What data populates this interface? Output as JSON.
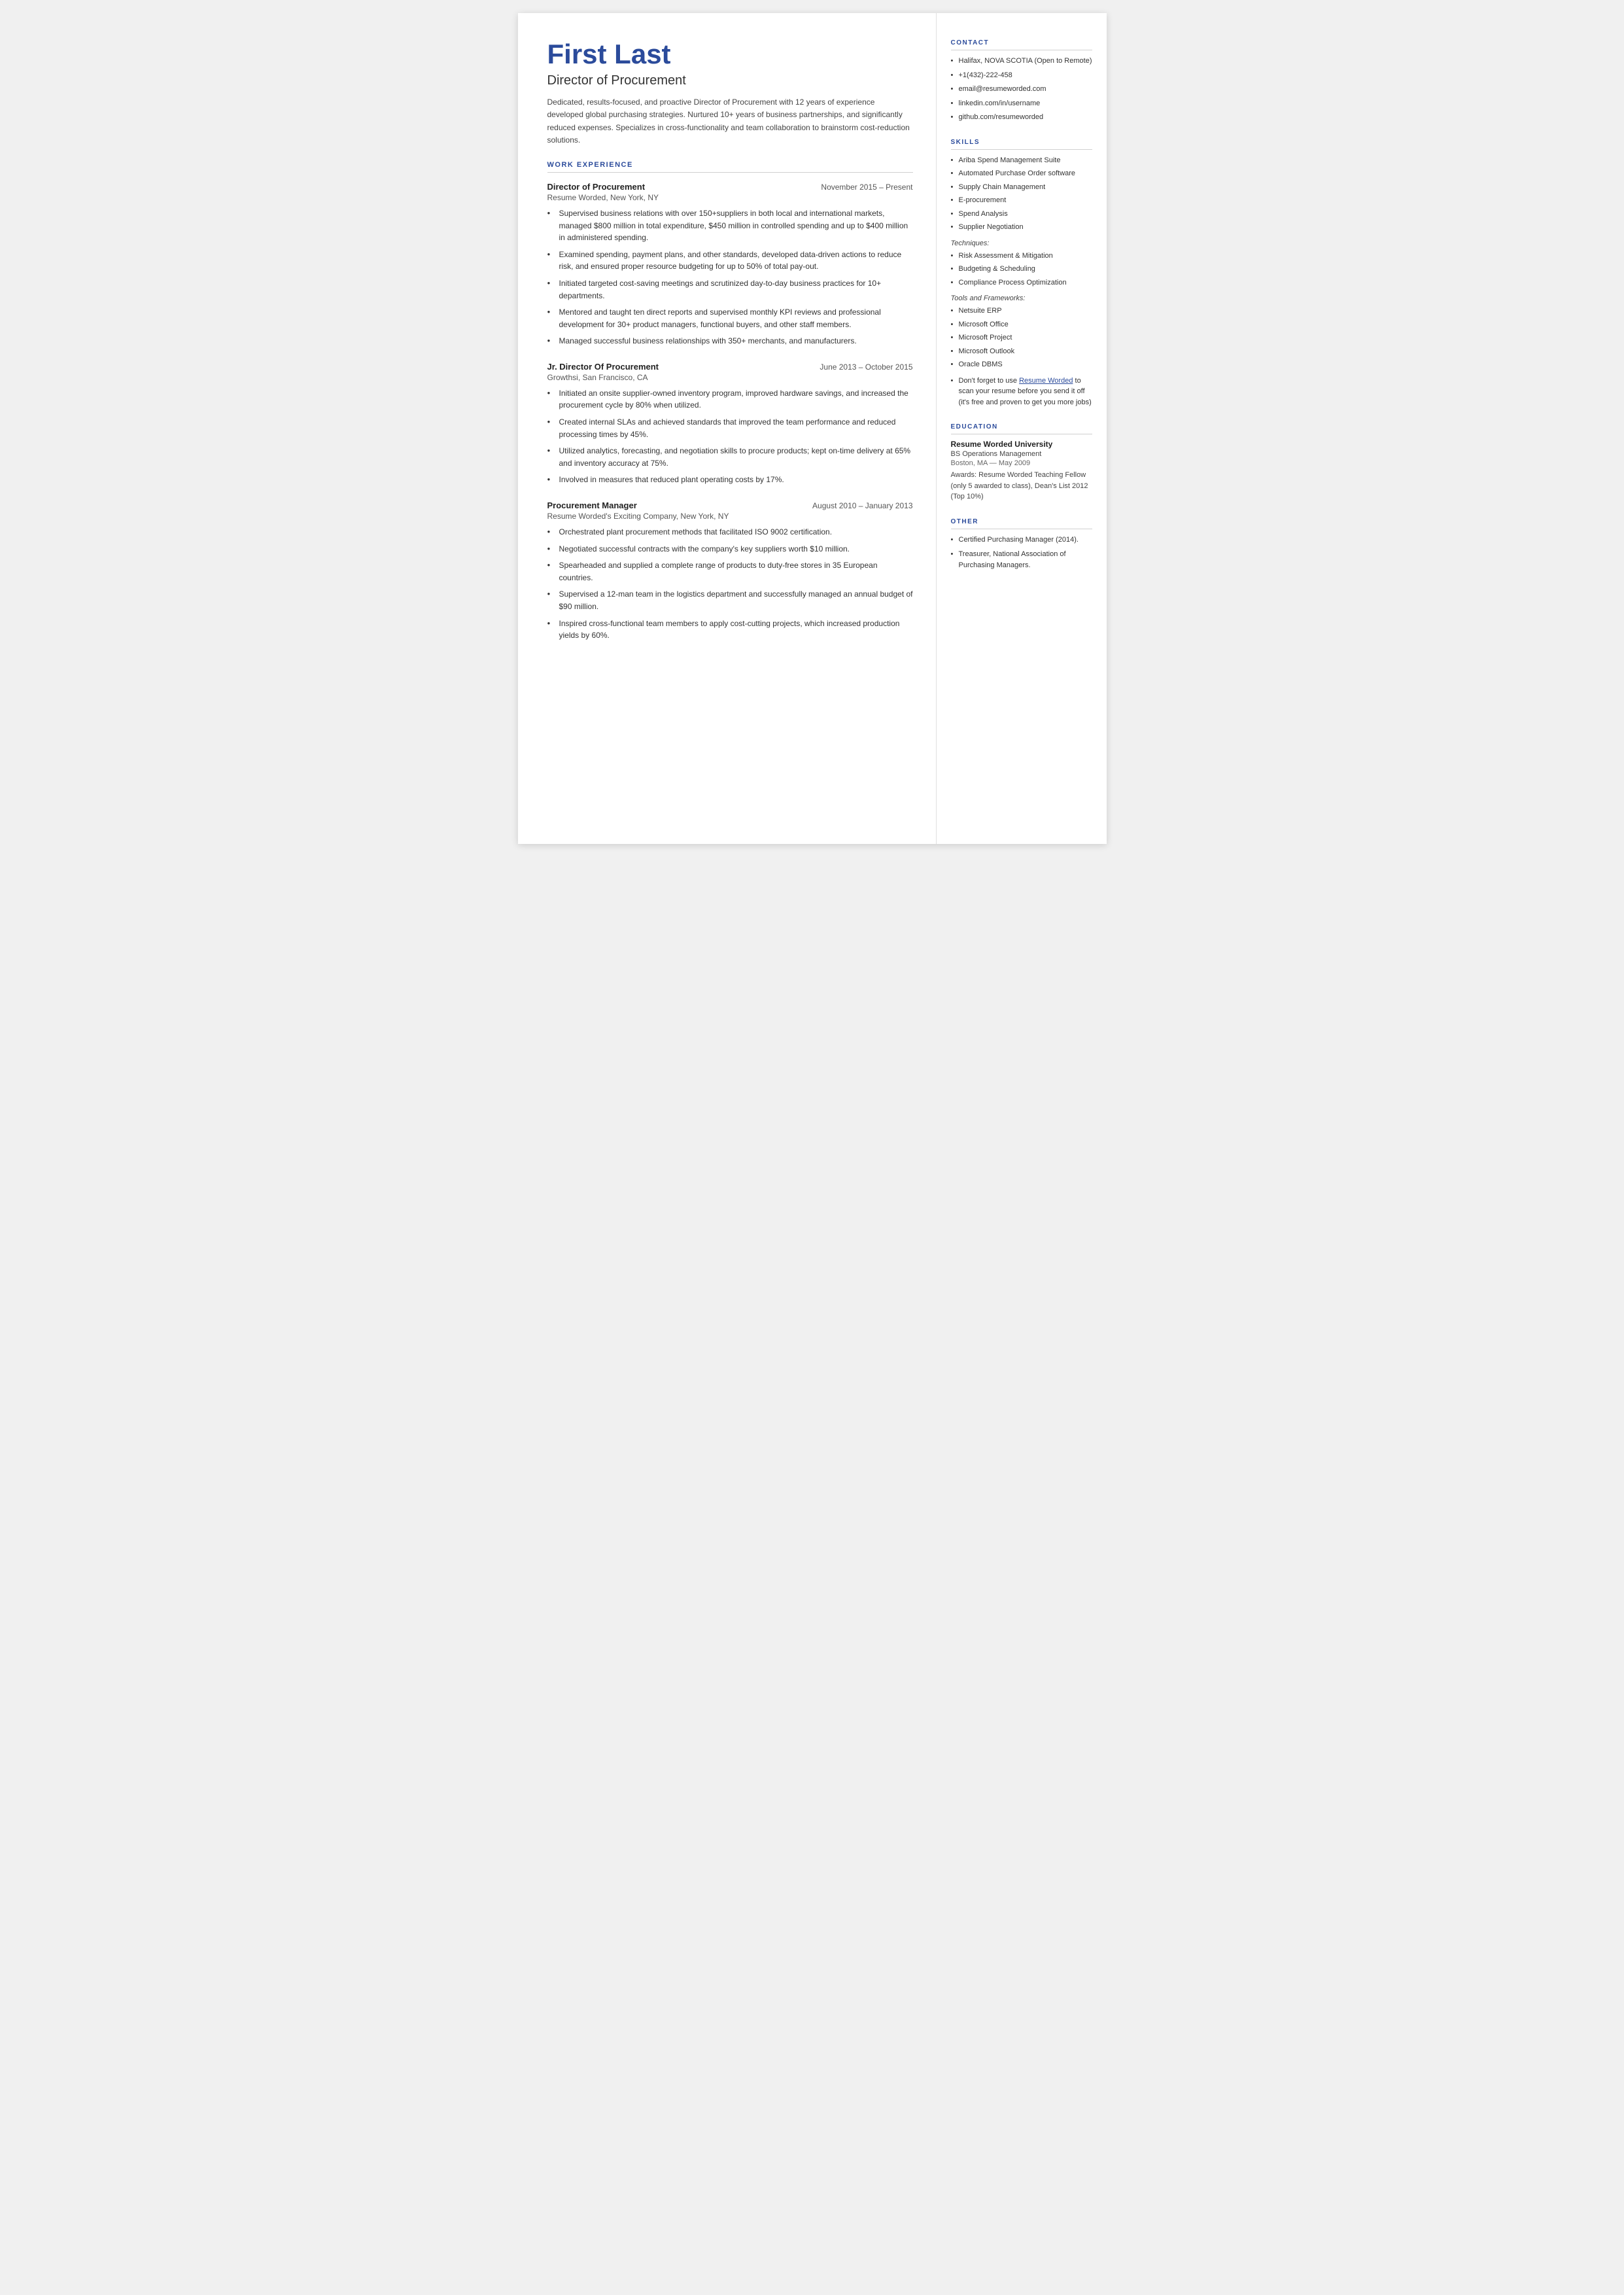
{
  "header": {
    "name": "First Last",
    "title": "Director of Procurement",
    "summary": "Dedicated, results-focused, and proactive Director of Procurement with 12 years of experience developed global purchasing strategies. Nurtured 10+ years of business partnerships, and significantly reduced expenses. Specializes in cross-functionality and team collaboration to brainstorm cost-reduction solutions."
  },
  "sections": {
    "work_experience_label": "WORK EXPERIENCE",
    "jobs": [
      {
        "title": "Director of Procurement",
        "dates": "November 2015 – Present",
        "company": "Resume Worded, New York, NY",
        "bullets": [
          "Supervised business relations with over 150+suppliers in both local and international markets, managed $800 million in total expenditure, $450 million in controlled spending and up to $400 million in administered spending.",
          "Examined spending, payment plans, and other standards, developed data-driven actions to reduce risk, and ensured proper resource budgeting for up to 50% of total pay-out.",
          "Initiated targeted cost-saving meetings and scrutinized day-to-day business practices for 10+ departments.",
          "Mentored and taught ten direct reports and supervised monthly KPI reviews and professional development for 30+ product managers, functional buyers, and other staff members.",
          "Managed successful business relationships with 350+ merchants, and manufacturers."
        ]
      },
      {
        "title": "Jr. Director Of Procurement",
        "dates": "June 2013 – October 2015",
        "company": "Growthsi, San Francisco, CA",
        "bullets": [
          "Initiated an onsite supplier-owned inventory program, improved hardware savings, and increased the procurement cycle by 80% when utilized.",
          "Created internal SLAs and achieved standards that improved the team performance and reduced processing times by 45%.",
          "Utilized analytics, forecasting, and negotiation skills to procure products; kept on-time delivery at 65% and inventory accuracy at 75%.",
          "Involved in measures that reduced plant operating costs by 17%."
        ]
      },
      {
        "title": "Procurement Manager",
        "dates": "August 2010 – January 2013",
        "company": "Resume Worded's Exciting Company, New York, NY",
        "bullets": [
          "Orchestrated plant procurement methods that facilitated ISO 9002 certification.",
          "Negotiated successful contracts with the company's key suppliers worth $10 million.",
          "Spearheaded and supplied a complete range of products to duty-free stores in 35 European countries.",
          "Supervised a 12-man team in the logistics department and successfully managed an annual budget of $90 million.",
          "Inspired cross-functional team members to apply cost-cutting projects, which increased production yields by 60%."
        ]
      }
    ]
  },
  "contact": {
    "label": "CONTACT",
    "items": [
      "Halifax, NOVA SCOTIA (Open to Remote)",
      "+1(432)-222-458",
      "email@resumeworded.com",
      "linkedin.com/in/username",
      "github.com/resumeworded"
    ]
  },
  "skills": {
    "label": "SKILLS",
    "main": [
      "Ariba Spend Management Suite",
      "Automated Purchase Order software",
      "Supply Chain Management",
      "E-procurement",
      "Spend Analysis",
      "Supplier Negotiation"
    ],
    "techniques_label": "Techniques:",
    "techniques": [
      "Risk Assessment & Mitigation",
      "Budgeting & Scheduling",
      "Compliance Process Optimization"
    ],
    "tools_label": "Tools and Frameworks:",
    "tools": [
      "Netsuite ERP",
      "Microsoft Office",
      "Microsoft Project",
      "Microsoft Outlook",
      "Oracle DBMS"
    ],
    "promo_text": "Don't forget to use ",
    "promo_link_text": "Resume Worded",
    "promo_link_url": "#",
    "promo_suffix": " to scan your resume before you send it off (it's free and proven to get you more jobs)"
  },
  "education": {
    "label": "EDUCATION",
    "school": "Resume Worded University",
    "degree": "BS Operations Management",
    "date": "Boston, MA — May 2009",
    "awards": "Awards: Resume Worded Teaching Fellow (only 5 awarded to class), Dean's List 2012 (Top 10%)"
  },
  "other": {
    "label": "OTHER",
    "items": [
      "Certified Purchasing Manager (2014).",
      "Treasurer, National Association of Purchasing Managers."
    ]
  }
}
